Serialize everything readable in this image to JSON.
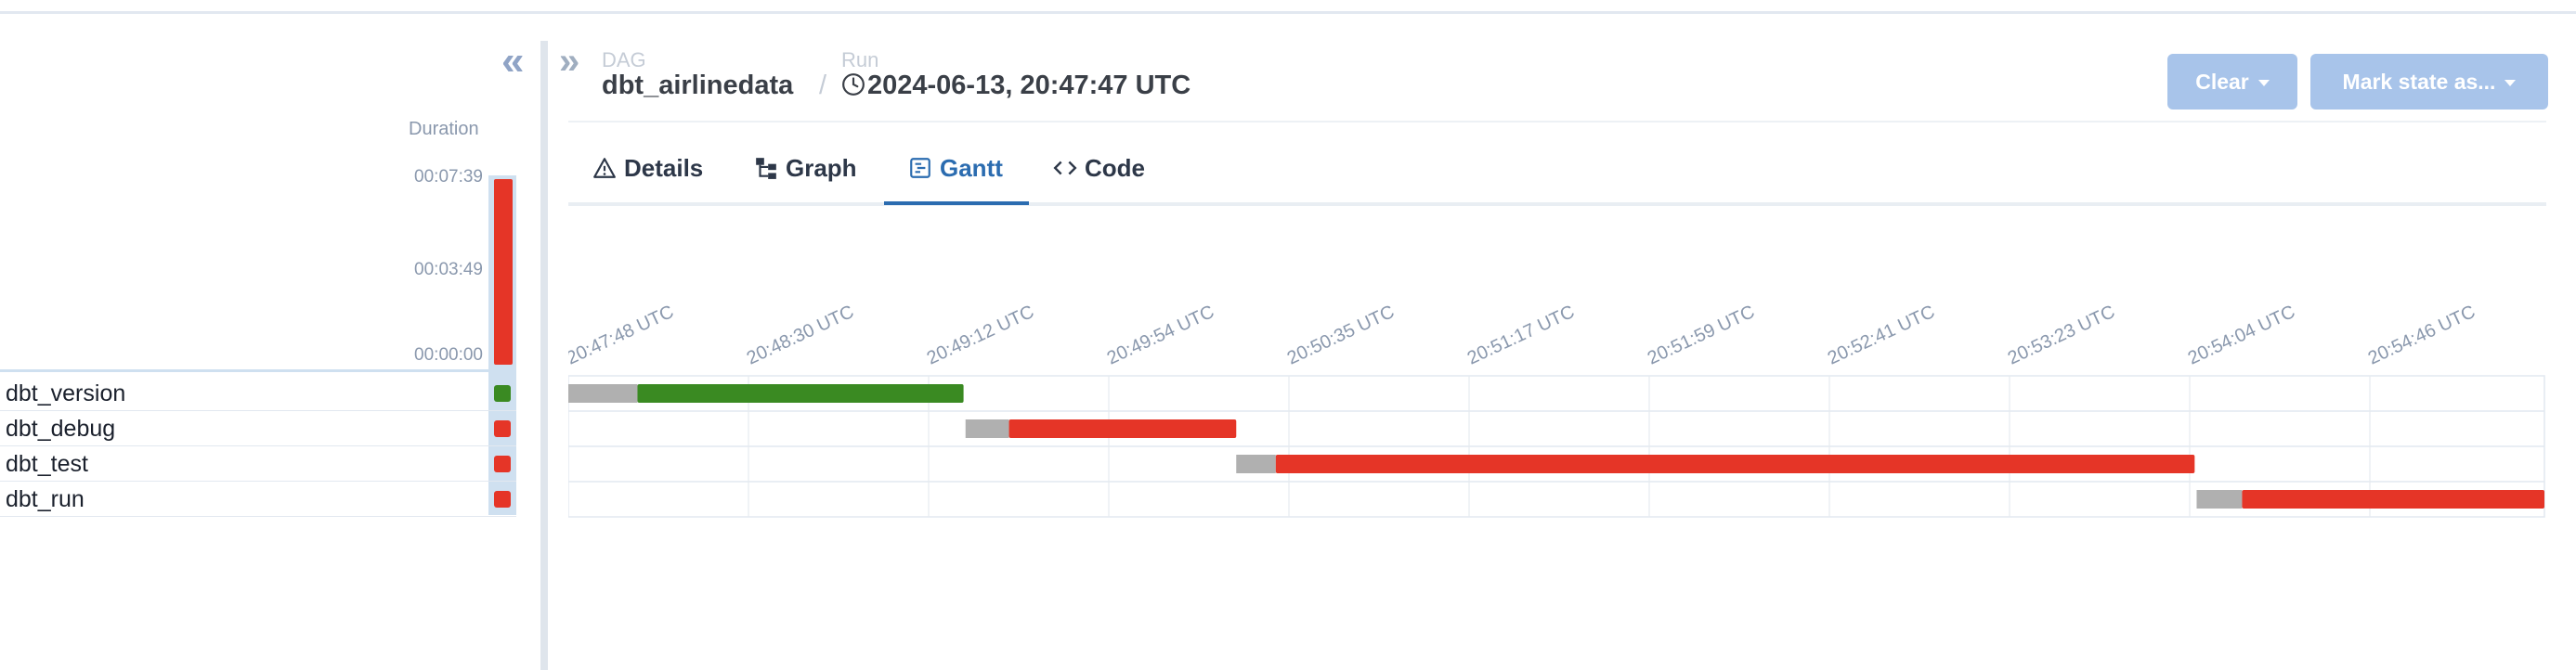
{
  "left": {
    "duration_title": "Duration",
    "duration_ticks": [
      "00:07:39",
      "00:03:49",
      "00:00:00"
    ],
    "run_duration_fraction": 1.0,
    "tasks": [
      {
        "name": "dbt_version",
        "status_color": "#3a8a22"
      },
      {
        "name": "dbt_debug",
        "status_color": "#e53527"
      },
      {
        "name": "dbt_test",
        "status_color": "#e53527"
      },
      {
        "name": "dbt_run",
        "status_color": "#e53527"
      }
    ]
  },
  "header": {
    "dag_label": "DAG",
    "dag_name": "dbt_airlinedata",
    "separator": "/",
    "run_label": "Run",
    "run_value": "2024-06-13, 20:47:47 UTC",
    "clear_label": "Clear",
    "mark_state_label": "Mark state as..."
  },
  "tabs": [
    {
      "label": "Details",
      "icon": "warning-icon"
    },
    {
      "label": "Graph",
      "icon": "graph-icon"
    },
    {
      "label": "Gantt",
      "icon": "gantt-icon",
      "active": true
    },
    {
      "label": "Code",
      "icon": "code-icon"
    }
  ],
  "gantt": {
    "time_ticks": [
      "20:47:48 UTC",
      "20:48:30 UTC",
      "20:49:12 UTC",
      "20:49:54 UTC",
      "20:50:35 UTC",
      "20:51:17 UTC",
      "20:51:59 UTC",
      "20:52:41 UTC",
      "20:53:23 UTC",
      "20:54:04 UTC",
      "20:54:46 UTC"
    ],
    "colors": {
      "queued": "#b0b0b0",
      "success": "#3a8a22",
      "failed": "#e53527"
    },
    "tasks": [
      {
        "name": "dbt_version",
        "queued_start": 0.0,
        "start": 0.035,
        "end": 0.2,
        "state": "success"
      },
      {
        "name": "dbt_debug",
        "queued_start": 0.201,
        "start": 0.223,
        "end": 0.338,
        "state": "failed"
      },
      {
        "name": "dbt_test",
        "queued_start": 0.338,
        "start": 0.358,
        "end": 0.823,
        "state": "failed"
      },
      {
        "name": "dbt_run",
        "queued_start": 0.824,
        "start": 0.847,
        "end": 1.0,
        "state": "failed"
      }
    ]
  }
}
